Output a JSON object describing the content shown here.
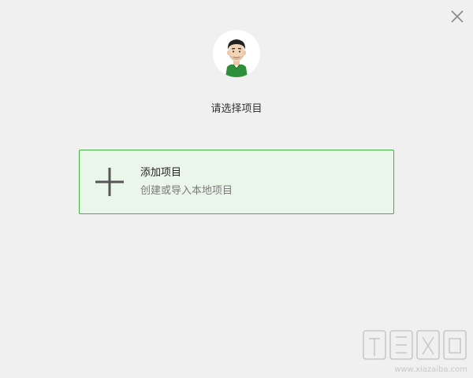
{
  "window": {
    "close_icon": "close-icon"
  },
  "header": {
    "avatar_icon": "user-avatar",
    "title": "请选择项目"
  },
  "add_project": {
    "icon": "plus-icon",
    "title": "添加项目",
    "subtitle": "创建或导入本地项目"
  },
  "watermark": {
    "logo": "watermark-logo",
    "url": "www.xiazaiba.com"
  },
  "colors": {
    "background": "#f0f0f0",
    "card_background": "#ebf6ea",
    "card_border": "#46b046",
    "plus_icon": "#555555",
    "close_icon": "#888888"
  }
}
